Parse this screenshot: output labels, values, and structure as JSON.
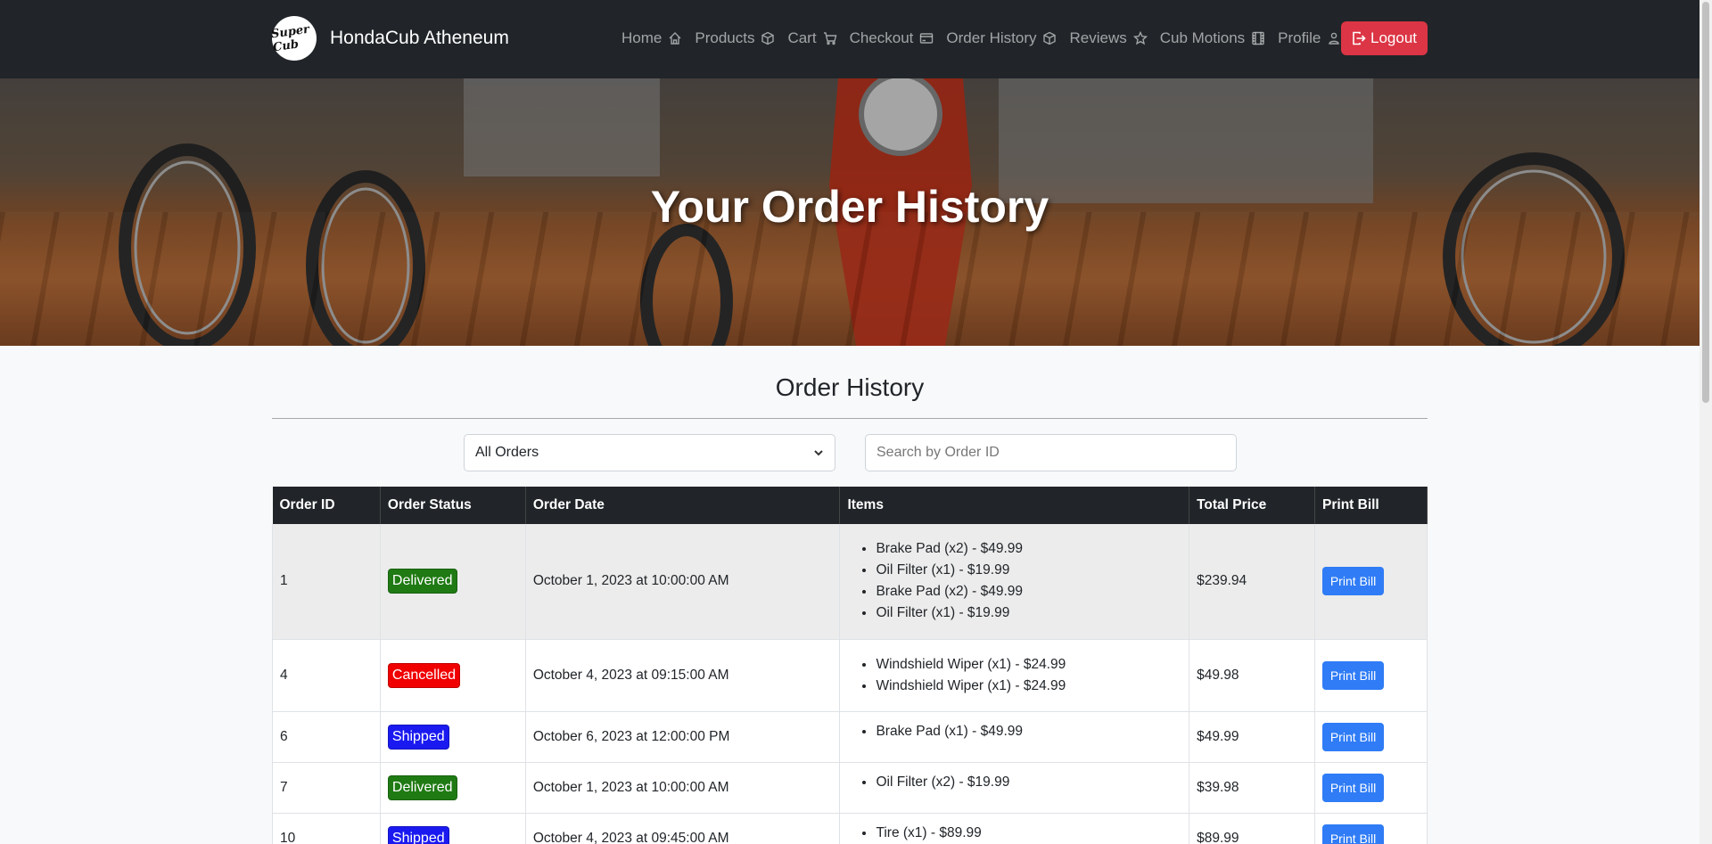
{
  "brand": {
    "logo_text": "Super Cub",
    "name": "HondaCub Atheneum"
  },
  "nav": {
    "items": [
      {
        "label": "Home",
        "icon": "home-icon"
      },
      {
        "label": "Products",
        "icon": "box-icon"
      },
      {
        "label": "Cart",
        "icon": "cart-icon"
      },
      {
        "label": "Checkout",
        "icon": "credit-card-icon"
      },
      {
        "label": "Order History",
        "icon": "box-icon"
      },
      {
        "label": "Reviews",
        "icon": "star-icon"
      },
      {
        "label": "Cub Motions",
        "icon": "film-icon"
      },
      {
        "label": "Profile",
        "icon": "person-icon"
      }
    ],
    "logout_label": "Logout"
  },
  "hero": {
    "title": "Your Order History"
  },
  "main": {
    "title": "Order History",
    "filter": {
      "selected": "All Orders"
    },
    "search": {
      "placeholder": "Search by Order ID",
      "value": ""
    }
  },
  "table": {
    "headers": [
      "Order ID",
      "Order Status",
      "Order Date",
      "Items",
      "Total Price",
      "Print Bill"
    ],
    "rows": [
      {
        "id": "1",
        "status": "Delivered",
        "status_color": "#1f7a13",
        "date": "October 1, 2023 at 10:00:00 AM",
        "items": [
          "Brake Pad (x2) - $49.99",
          "Oil Filter (x1) - $19.99",
          "Brake Pad (x2) - $49.99",
          "Oil Filter (x1) - $19.99"
        ],
        "total": "$239.94",
        "print_label": "Print Bill"
      },
      {
        "id": "4",
        "status": "Cancelled",
        "status_color": "#f00000",
        "date": "October 4, 2023 at 09:15:00 AM",
        "items": [
          "Windshield Wiper (x1) - $24.99",
          "Windshield Wiper (x1) - $24.99"
        ],
        "total": "$49.98",
        "print_label": "Print Bill"
      },
      {
        "id": "6",
        "status": "Shipped",
        "status_color": "#1a1af0",
        "date": "October 6, 2023 at 12:00:00 PM",
        "items": [
          "Brake Pad (x1) - $49.99"
        ],
        "total": "$49.99",
        "print_label": "Print Bill"
      },
      {
        "id": "7",
        "status": "Delivered",
        "status_color": "#1f7a13",
        "date": "October 1, 2023 at 10:00:00 AM",
        "items": [
          "Oil Filter (x2) - $19.99"
        ],
        "total": "$39.98",
        "print_label": "Print Bill"
      },
      {
        "id": "10",
        "status": "Shipped",
        "status_color": "#1a1af0",
        "date": "October 4, 2023 at 09:45:00 AM",
        "items": [
          "Tire (x1) - $89.99"
        ],
        "total": "$89.99",
        "print_label": "Print Bill"
      }
    ]
  }
}
